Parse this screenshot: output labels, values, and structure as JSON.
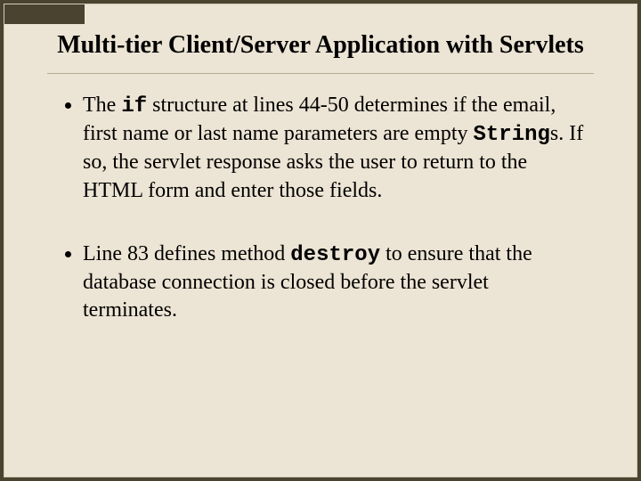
{
  "title": "Multi-tier Client/Server Application with Servlets",
  "bullets": [
    {
      "pre": "The ",
      "code": "if",
      "mid": " structure at lines 44-50 determines if the email, first name or last name parameters are empty ",
      "code2": "String",
      "post": "s. If so, the servlet response asks the user to return to the HTML form and enter those fields."
    },
    {
      "pre": "Line 83 defines method ",
      "code": "destroy",
      "mid": " to ensure that the database connection is closed before the servlet terminates.",
      "code2": "",
      "post": ""
    }
  ]
}
